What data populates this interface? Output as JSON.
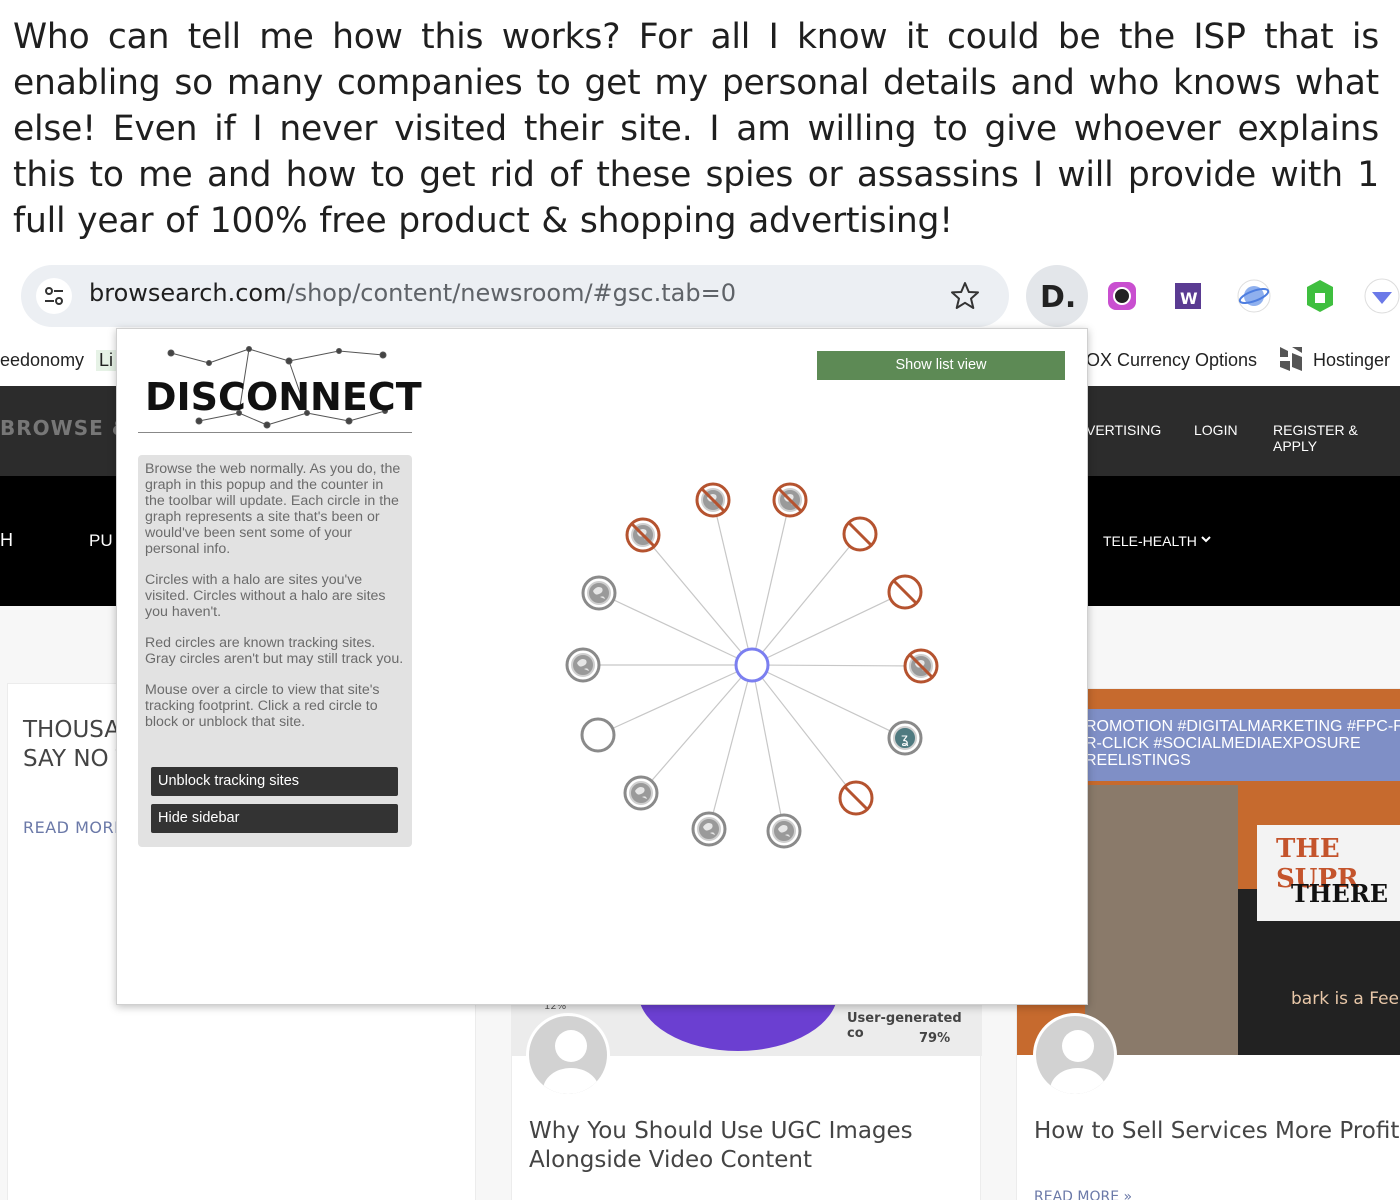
{
  "caption": "Who can tell me how this works?  For all I know it could be the ISP that is enabling so many companies to get my personal details and who knows what else! Even if I never visited their site. I am willing to give whoever explains this to me and how to get rid of these spies or assassins I will provide with 1 full  year of 100% free product & shopping advertising!",
  "browser": {
    "url_domain": "browsearch.com",
    "url_path": "/shop/content/newsroom/#gsc.tab=0"
  },
  "bookmarks": {
    "left": "eedonomy",
    "left_tag": "Li",
    "currency": "OX Currency Options",
    "hostinger": "Hostinger"
  },
  "site": {
    "logo": "BROWSE & SE",
    "header_nav": [
      "VERTISING",
      "LOGIN",
      "REGISTER & APPLY"
    ],
    "menu_left_1": "H",
    "menu_left_2": "PU",
    "menu_right": "TELE-HEALTH"
  },
  "cards": {
    "card1_title": "THOUSA\nSAY NO T",
    "card1_more": "READ MORE",
    "card2_chart_label": "User-generated co",
    "card2_chart_pct": "79%",
    "card2_chart_pct2": "12%",
    "card2_title": "Why You Should Use UGC Images Alongside Video Content",
    "card3_band": "ROMOTION #DIGITALMARKETING #FPC-F\nR-CLICK #SOCIALMEDIAEXPOSURE\nREELISTINGS",
    "card3_supr": "THE SUPR",
    "card3_there": "THERE",
    "card3_bark": "bark is a Fee",
    "card3_title": "How to Sell Services More Profitab",
    "card3_more": "READ MORE »"
  },
  "disconnect": {
    "logo": "DISCONNECT",
    "list_view_button": "Show list view",
    "sidebar_p1": "Browse the web normally. As you do, the graph in this popup and the counter in the toolbar will update. Each circle in the graph represents a site that's been or would've been sent some of your personal info.",
    "sidebar_p2": "Circles with a halo are sites you've visited. Circles without a halo are sites you haven't.",
    "sidebar_p3": "Red circles are known tracking sites. Gray circles aren't but may still track you.",
    "sidebar_p4": "Mouse over a circle to view that site's tracking footprint. Click a red circle to block or unblock that site.",
    "unblock_button": "Unblock tracking sites",
    "hide_sidebar_button": "Hide sidebar"
  },
  "graph_nodes": [
    {
      "type": "tracker-blocked",
      "halo": true
    },
    {
      "type": "tracker-blocked",
      "halo": true
    },
    {
      "type": "tracker-blocked",
      "halo": false
    },
    {
      "type": "tracker-blocked",
      "halo": false
    },
    {
      "type": "tracker-blocked",
      "halo": true
    },
    {
      "type": "site",
      "halo": true,
      "icon": "green-app"
    },
    {
      "type": "tracker-blocked",
      "halo": false
    },
    {
      "type": "site",
      "halo": true
    },
    {
      "type": "site",
      "halo": true
    },
    {
      "type": "site",
      "halo": true
    },
    {
      "type": "site",
      "halo": false,
      "icon": "empty"
    },
    {
      "type": "site",
      "halo": true
    },
    {
      "type": "site",
      "halo": true
    },
    {
      "type": "tracker-blocked",
      "halo": true
    }
  ],
  "colors": {
    "tracker": "#b5532f",
    "site": "#8a8a8a",
    "center": "#7b7ff0",
    "list_view": "#5d8a55"
  }
}
